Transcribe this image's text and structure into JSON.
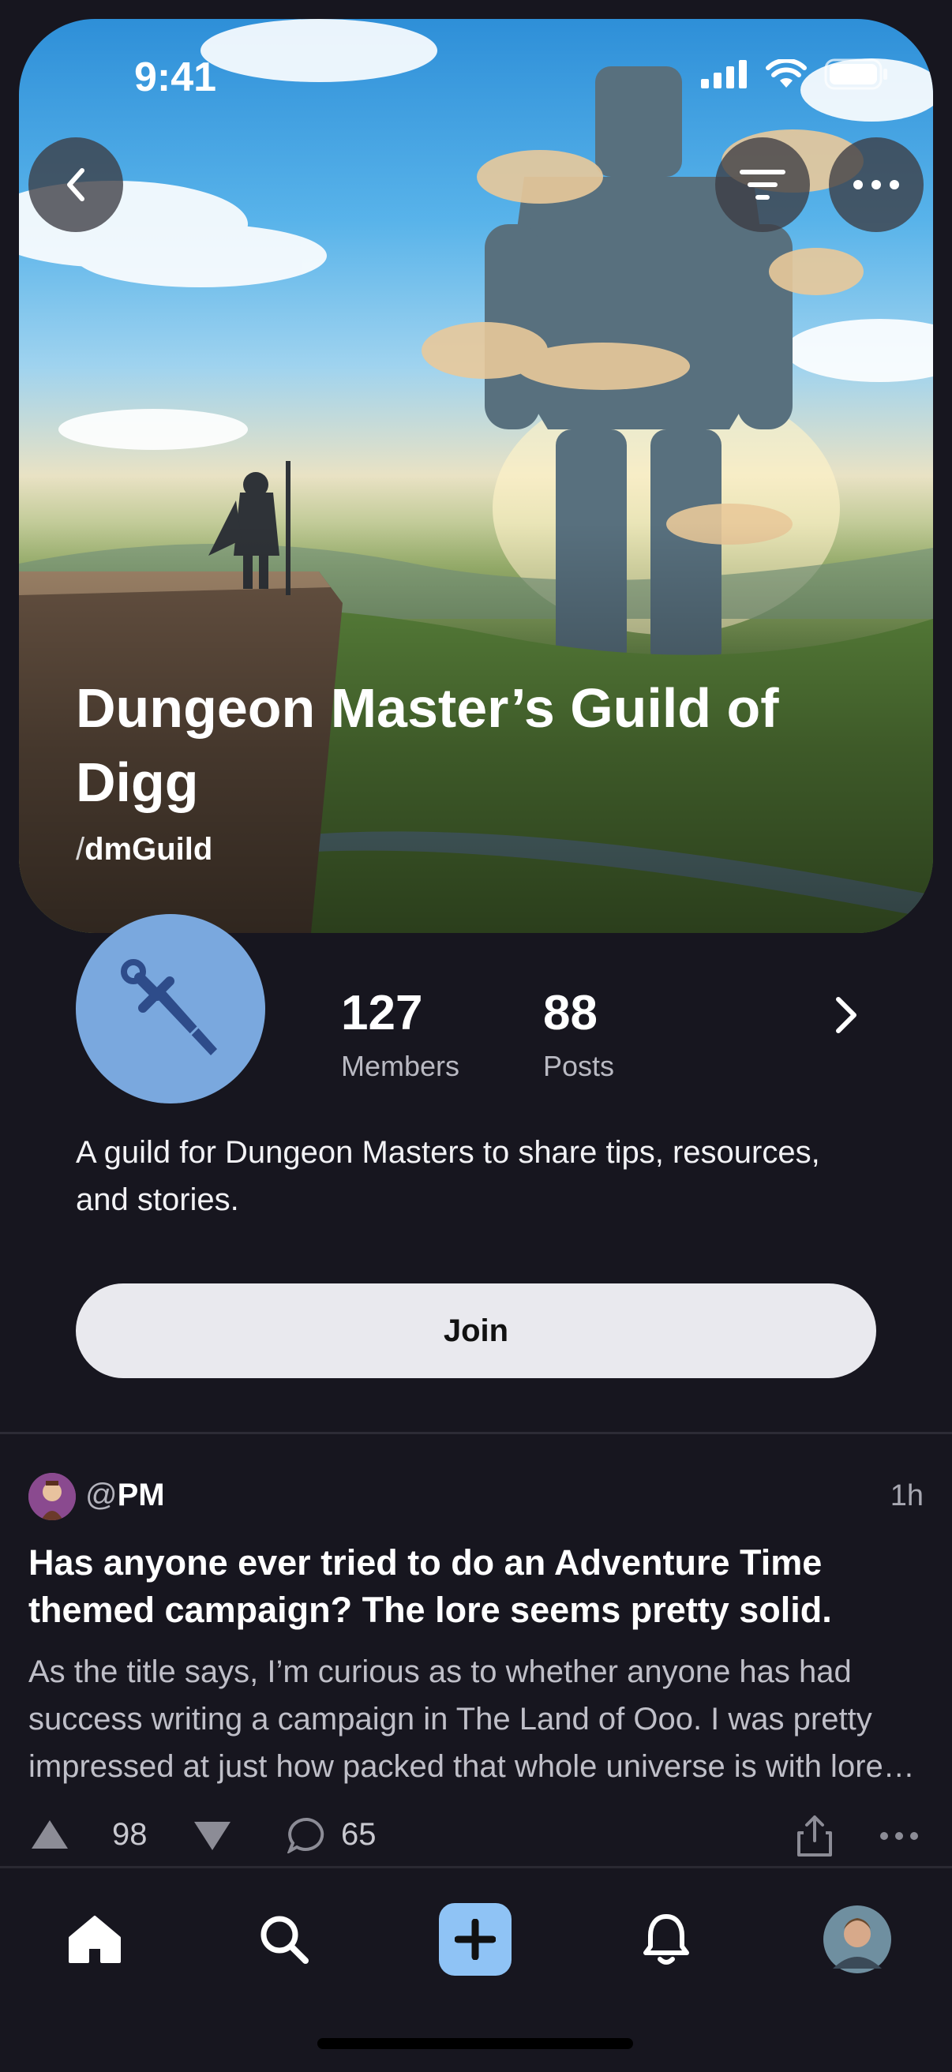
{
  "status_bar": {
    "time": "9:41"
  },
  "header": {
    "title": "Dungeon Master’s Guild of Digg",
    "handle_prefix": "/",
    "handle": "dmGuild",
    "icons": [
      "back-chevron-icon",
      "filter-icon",
      "more-horizontal-icon"
    ]
  },
  "stats": {
    "members_count": "127",
    "members_label": "Members",
    "posts_count": "88",
    "posts_label": "Posts"
  },
  "description": "A guild for Dungeon Masters to share tips, resources, and stories.",
  "join_label": "Join",
  "post": {
    "username_prefix": "@",
    "username": "PM",
    "time": "1h",
    "title": "Has anyone ever tried to do an Adventure Time themed campaign? The lore seems pretty solid.",
    "body": "As the title says, I’m curious as to whether anyone has had success writing a campaign in The Land of Ooo. I was pretty impressed at just how packed that whole universe is with lore and history.",
    "upvotes": "98",
    "comments": "65"
  },
  "tabbar": {
    "items": [
      "home-icon",
      "search-icon",
      "create-post-icon",
      "notifications-bell-icon",
      "profile-avatar"
    ]
  },
  "colors": {
    "background": "#17161f",
    "join_button": "#e9e9ee",
    "guild_avatar": "#7aa8de",
    "create_button": "#8fc3f5"
  }
}
